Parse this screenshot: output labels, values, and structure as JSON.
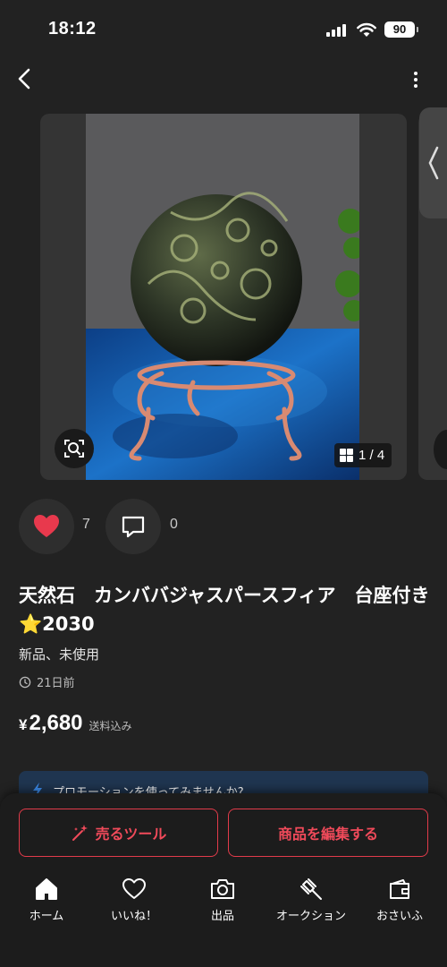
{
  "status_bar": {
    "time": "18:12",
    "battery": "90"
  },
  "gallery": {
    "counter": "1 / 4"
  },
  "actions": {
    "like_count": "7",
    "comment_count": "0"
  },
  "product": {
    "title": "天然石　カンババジャスパースフィア　台座付き⭐️2030",
    "condition": "新品、未使用",
    "posted_ago": "21日前",
    "price_symbol": "¥",
    "price": "2,680",
    "shipping": "送料込み"
  },
  "promo": {
    "text": "プロモーションを使ってみませんか?"
  },
  "buttons": {
    "sell_tool": "売るツール",
    "edit_item": "商品を編集する"
  },
  "tabs": [
    {
      "label": "ホーム",
      "icon": "home-icon"
    },
    {
      "label": "いいね！",
      "icon": "heart-icon"
    },
    {
      "label": "出品",
      "icon": "camera-icon"
    },
    {
      "label": "オークション",
      "icon": "gavel-icon"
    },
    {
      "label": "おさいふ",
      "icon": "wallet-icon"
    }
  ],
  "colors": {
    "accent": "#e23b4a",
    "background": "#222222",
    "like": "#e8394d"
  }
}
